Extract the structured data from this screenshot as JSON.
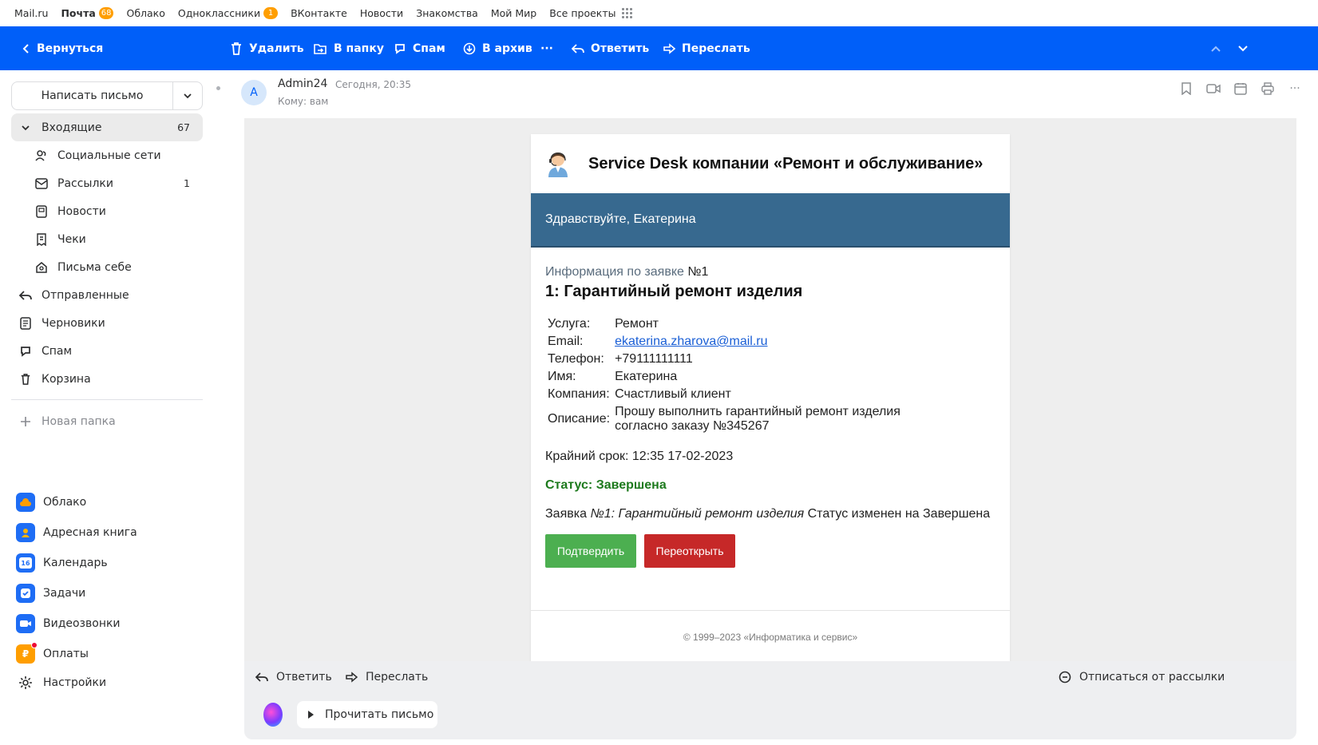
{
  "portal": {
    "items": [
      {
        "label": "Mail.ru"
      },
      {
        "label": "Почта",
        "badge": "68"
      },
      {
        "label": "Облако"
      },
      {
        "label": "Одноклассники",
        "badge": "1"
      },
      {
        "label": "ВКонтакте"
      },
      {
        "label": "Новости"
      },
      {
        "label": "Знакомства"
      },
      {
        "label": "Мой Мир"
      },
      {
        "label": "Все проекты"
      }
    ]
  },
  "toolbar": {
    "back": "Вернуться",
    "delete": "Удалить",
    "to_folder": "В папку",
    "spam": "Спам",
    "archive": "В архив",
    "more": "···",
    "reply": "Ответить",
    "forward": "Переслать"
  },
  "sidebar": {
    "compose": "Написать письмо",
    "folders": [
      {
        "label": "Входящие",
        "count": "67"
      },
      {
        "label": "Социальные сети",
        "count": ""
      },
      {
        "label": "Рассылки",
        "count": "1"
      },
      {
        "label": "Новости",
        "count": ""
      },
      {
        "label": "Чеки",
        "count": ""
      },
      {
        "label": "Письма себе",
        "count": ""
      },
      {
        "label": "Отправленные",
        "count": ""
      },
      {
        "label": "Черновики",
        "count": ""
      },
      {
        "label": "Спам",
        "count": ""
      },
      {
        "label": "Корзина",
        "count": ""
      }
    ],
    "new_folder": "Новая папка",
    "apps": [
      {
        "label": "Облако"
      },
      {
        "label": "Адресная книга"
      },
      {
        "label": "Календарь",
        "icon_text": "16"
      },
      {
        "label": "Задачи"
      },
      {
        "label": "Видеозвонки"
      },
      {
        "label": "Оплаты"
      },
      {
        "label": "Настройки"
      }
    ]
  },
  "message": {
    "avatar_letter": "A",
    "sender": "Admin24",
    "date": "Сегодня, 20:35",
    "to": "Кому: вам"
  },
  "email": {
    "header_title": "Service Desk компании «Ремонт и обслуживание»",
    "greeting": "Здравствуйте, Екатерина",
    "info_prefix": "Информация по заявке",
    "info_number": "№1",
    "request_title": "1: Гарантийный ремонт изделия",
    "details": [
      {
        "label": "Услуга:",
        "value": "Ремонт"
      },
      {
        "label": "Email:",
        "value": "ekaterina.zharova@mail.ru"
      },
      {
        "label": "Телефон:",
        "value": "+79111111111"
      },
      {
        "label": "Имя:",
        "value": "Екатерина"
      },
      {
        "label": "Компания:",
        "value": "Счастливый клиент"
      },
      {
        "label": "Описание:",
        "value": "Прошу выполнить гарантийный ремонт изделия согласно заказу №345267"
      }
    ],
    "deadline": "Крайний срок: 12:35 17-02-2023",
    "status": "Статус: Завершена",
    "changed_prefix": "Заявка",
    "changed_italic": "№1: Гарантийный ремонт изделия",
    "changed_suffix": "Статус изменен на Завершена",
    "confirm_button": "Подтвердить",
    "reopen_button": "Переоткрыть",
    "footer": "© 1999–2023 «Информатика и сервис»"
  },
  "reply_bar": {
    "reply": "Ответить",
    "forward": "Переслать",
    "unsubscribe": "Отписаться от рассылки",
    "read_aloud": "Прочитать письмо"
  },
  "colors": {
    "toolbar": "#005ff9",
    "greeting_band": "#37698f",
    "status_green": "#1d7a1d",
    "confirm": "#4caf50",
    "reopen": "#c62828"
  }
}
